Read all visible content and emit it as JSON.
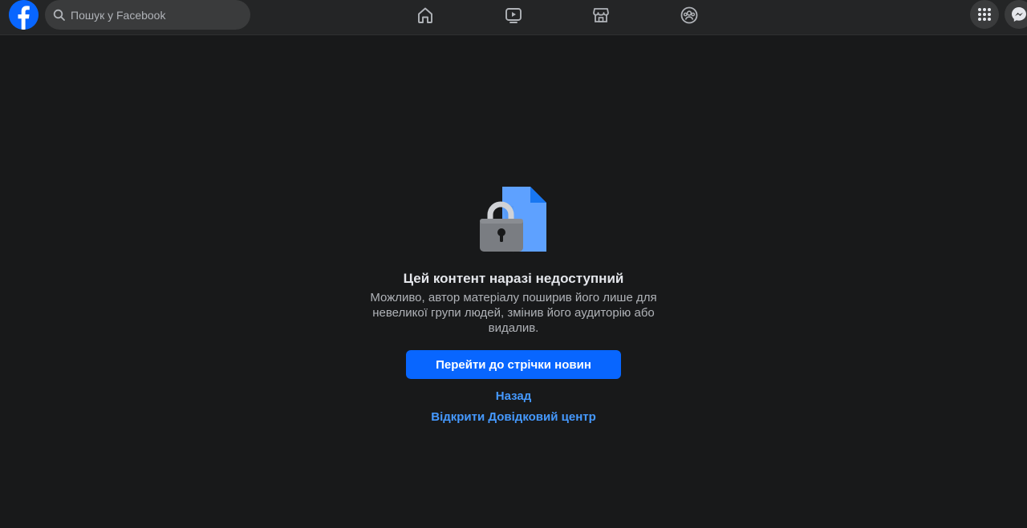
{
  "header": {
    "search": {
      "placeholder": "Пошук у Facebook"
    },
    "nav": [
      {
        "icon": "home-icon"
      },
      {
        "icon": "video-icon"
      },
      {
        "icon": "marketplace-icon"
      },
      {
        "icon": "groups-icon"
      }
    ],
    "right": [
      {
        "icon": "menu-grid-icon"
      },
      {
        "icon": "messenger-icon"
      }
    ],
    "brand_color": "#0866ff"
  },
  "main": {
    "illustration": "locked-document-icon",
    "title": "Цей контент наразі недоступний",
    "description": "Можливо, автор матеріалу поширив його лише для невеликої групи людей, змінив його аудиторію або видалив.",
    "primary_button": "Перейти до стрічки новин",
    "back_link": "Назад",
    "help_link": "Відкрити Довідковий центр"
  }
}
